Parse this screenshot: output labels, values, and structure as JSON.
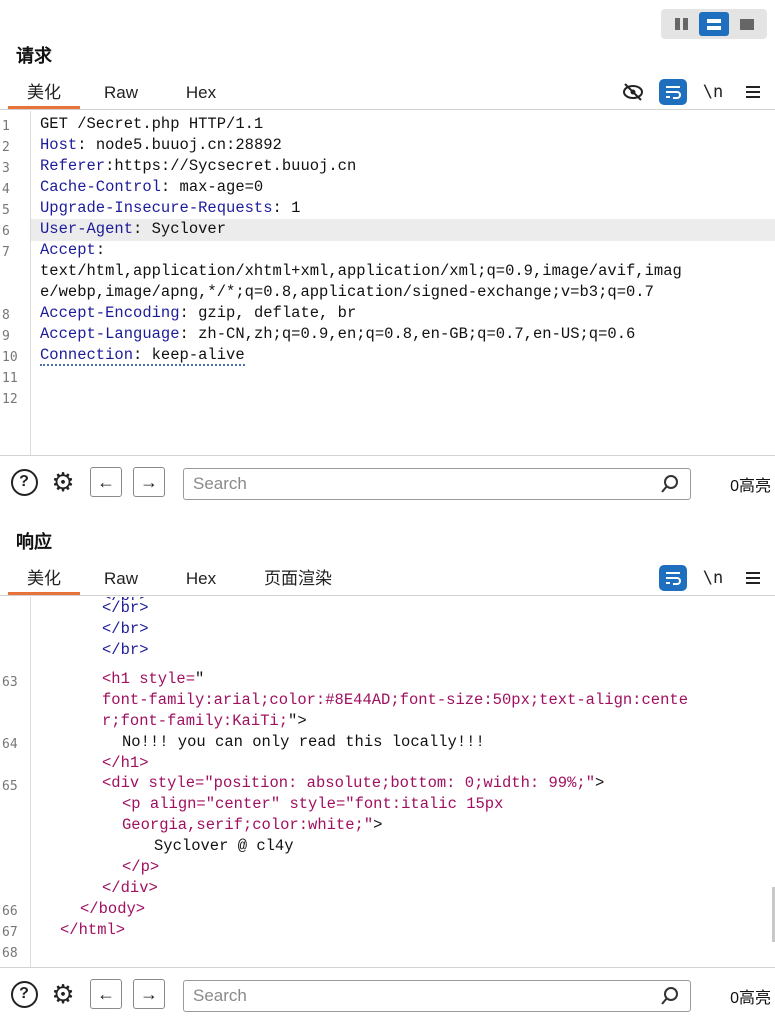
{
  "request": {
    "title": "请求",
    "tabs": [
      "美化",
      "Raw",
      "Hex"
    ],
    "lines": [
      {
        "n": "1",
        "key": "",
        "rest": "GET /Secret.php HTTP/1.1"
      },
      {
        "n": "2",
        "key": "Host",
        "rest": ": node5.buuoj.cn:28892"
      },
      {
        "n": "3",
        "key": "Referer",
        "rest": ":https://Sycsecret.buuoj.cn"
      },
      {
        "n": "4",
        "key": "Cache-Control",
        "rest": ": max-age=0"
      },
      {
        "n": "5",
        "key": "Upgrade-Insecure-Requests",
        "rest": ": 1"
      },
      {
        "n": "6",
        "key": "User-Agent",
        "rest": ": Syclover"
      },
      {
        "n": "7",
        "key": "Accept",
        "rest": ":"
      },
      {
        "n": "",
        "key": "",
        "rest": "text/html,application/xhtml+xml,application/xml;q=0.9,image/avif,imag"
      },
      {
        "n": "",
        "key": "",
        "rest": "e/webp,image/apng,*/*;q=0.8,application/signed-exchange;v=b3;q=0.7"
      },
      {
        "n": "8",
        "key": "Accept-Encoding",
        "rest": ": gzip, deflate, br"
      },
      {
        "n": "9",
        "key": "Accept-Language",
        "rest": ": zh-CN,zh;q=0.9,en;q=0.8,en-GB;q=0.7,en-US;q=0.6"
      },
      {
        "n": "10",
        "key": "Connection",
        "rest": ": keep-alive"
      },
      {
        "n": "11",
        "key": "",
        "rest": ""
      },
      {
        "n": "12",
        "key": "",
        "rest": ""
      }
    ],
    "search_placeholder": "Search",
    "hits": "0高亮"
  },
  "response": {
    "title": "响应",
    "tabs": [
      "美化",
      "Raw",
      "Hex",
      "页面渲染"
    ],
    "code": {
      "l0": "</br>",
      "l1": "</br>",
      "l2": "</br>",
      "l3": "</br>",
      "l4_tag": "<h1",
      "l4_attr": " style=",
      "l4_q": "\"",
      "l5": "font-family:arial;color:#8E44AD;font-size:50px;text-align:cente",
      "l6_val": "r;font-family:KaiTi;",
      "l6_end": "\">",
      "l7": "No!!! you can only read this locally!!!",
      "l8": "</h1>",
      "l9_tag": "<div",
      "l9_attr": " style=",
      "l9_val": "\"position: absolute;bottom: 0;width: 99%;\"",
      "l9_end": ">",
      "l10_tag": "<p",
      "l10_attr1": " align=",
      "l10_val1": "\"center\"",
      "l10_attr2": " style=",
      "l10_val2": "\"font:italic 15px",
      "l11_val": "Georgia,serif;color:white;\"",
      "l11_end": ">",
      "l12": "Syclover @ cl4y",
      "l13": "</p>",
      "l14": "</div>",
      "l15": "</body>",
      "l16": "</html>"
    },
    "line_numbers": {
      "a": "63",
      "b": "64",
      "c": "65",
      "d": "66",
      "e": "67",
      "f": "68"
    },
    "search_placeholder": "Search",
    "hits": "0高亮"
  },
  "icons": {
    "layout": [
      "columns-layout-icon",
      "rows-layout-icon",
      "single-layout-icon"
    ],
    "toolbar": [
      "hide-icon",
      "wrap-icon",
      "newline-icon",
      "menu-icon"
    ],
    "bottom": [
      "help-icon",
      "settings-icon",
      "back-icon",
      "forward-icon",
      "search-icon"
    ]
  },
  "colors": {
    "accent": "#1f6fbf",
    "active_tab": "#e8733a",
    "header_key": "#1c1c9a",
    "tag": "#a01060"
  }
}
